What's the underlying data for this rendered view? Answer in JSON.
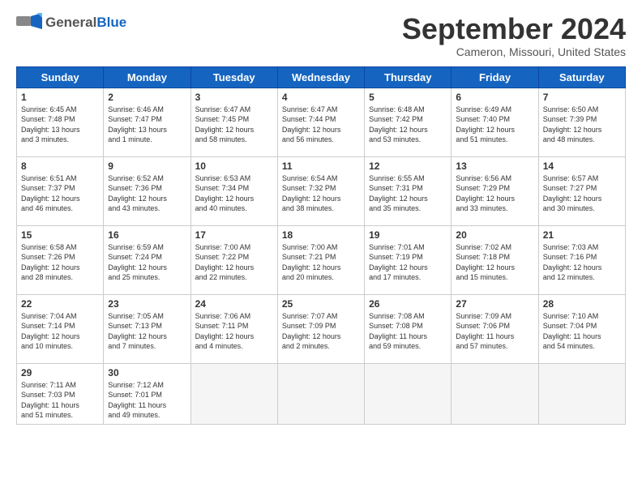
{
  "header": {
    "logo_general": "General",
    "logo_blue": "Blue",
    "title": "September 2024",
    "subtitle": "Cameron, Missouri, United States"
  },
  "days_of_week": [
    "Sunday",
    "Monday",
    "Tuesday",
    "Wednesday",
    "Thursday",
    "Friday",
    "Saturday"
  ],
  "weeks": [
    [
      {
        "day": "1",
        "info": "Sunrise: 6:45 AM\nSunset: 7:48 PM\nDaylight: 13 hours\nand 3 minutes."
      },
      {
        "day": "2",
        "info": "Sunrise: 6:46 AM\nSunset: 7:47 PM\nDaylight: 13 hours\nand 1 minute."
      },
      {
        "day": "3",
        "info": "Sunrise: 6:47 AM\nSunset: 7:45 PM\nDaylight: 12 hours\nand 58 minutes."
      },
      {
        "day": "4",
        "info": "Sunrise: 6:47 AM\nSunset: 7:44 PM\nDaylight: 12 hours\nand 56 minutes."
      },
      {
        "day": "5",
        "info": "Sunrise: 6:48 AM\nSunset: 7:42 PM\nDaylight: 12 hours\nand 53 minutes."
      },
      {
        "day": "6",
        "info": "Sunrise: 6:49 AM\nSunset: 7:40 PM\nDaylight: 12 hours\nand 51 minutes."
      },
      {
        "day": "7",
        "info": "Sunrise: 6:50 AM\nSunset: 7:39 PM\nDaylight: 12 hours\nand 48 minutes."
      }
    ],
    [
      {
        "day": "8",
        "info": "Sunrise: 6:51 AM\nSunset: 7:37 PM\nDaylight: 12 hours\nand 46 minutes."
      },
      {
        "day": "9",
        "info": "Sunrise: 6:52 AM\nSunset: 7:36 PM\nDaylight: 12 hours\nand 43 minutes."
      },
      {
        "day": "10",
        "info": "Sunrise: 6:53 AM\nSunset: 7:34 PM\nDaylight: 12 hours\nand 40 minutes."
      },
      {
        "day": "11",
        "info": "Sunrise: 6:54 AM\nSunset: 7:32 PM\nDaylight: 12 hours\nand 38 minutes."
      },
      {
        "day": "12",
        "info": "Sunrise: 6:55 AM\nSunset: 7:31 PM\nDaylight: 12 hours\nand 35 minutes."
      },
      {
        "day": "13",
        "info": "Sunrise: 6:56 AM\nSunset: 7:29 PM\nDaylight: 12 hours\nand 33 minutes."
      },
      {
        "day": "14",
        "info": "Sunrise: 6:57 AM\nSunset: 7:27 PM\nDaylight: 12 hours\nand 30 minutes."
      }
    ],
    [
      {
        "day": "15",
        "info": "Sunrise: 6:58 AM\nSunset: 7:26 PM\nDaylight: 12 hours\nand 28 minutes."
      },
      {
        "day": "16",
        "info": "Sunrise: 6:59 AM\nSunset: 7:24 PM\nDaylight: 12 hours\nand 25 minutes."
      },
      {
        "day": "17",
        "info": "Sunrise: 7:00 AM\nSunset: 7:22 PM\nDaylight: 12 hours\nand 22 minutes."
      },
      {
        "day": "18",
        "info": "Sunrise: 7:00 AM\nSunset: 7:21 PM\nDaylight: 12 hours\nand 20 minutes."
      },
      {
        "day": "19",
        "info": "Sunrise: 7:01 AM\nSunset: 7:19 PM\nDaylight: 12 hours\nand 17 minutes."
      },
      {
        "day": "20",
        "info": "Sunrise: 7:02 AM\nSunset: 7:18 PM\nDaylight: 12 hours\nand 15 minutes."
      },
      {
        "day": "21",
        "info": "Sunrise: 7:03 AM\nSunset: 7:16 PM\nDaylight: 12 hours\nand 12 minutes."
      }
    ],
    [
      {
        "day": "22",
        "info": "Sunrise: 7:04 AM\nSunset: 7:14 PM\nDaylight: 12 hours\nand 10 minutes."
      },
      {
        "day": "23",
        "info": "Sunrise: 7:05 AM\nSunset: 7:13 PM\nDaylight: 12 hours\nand 7 minutes."
      },
      {
        "day": "24",
        "info": "Sunrise: 7:06 AM\nSunset: 7:11 PM\nDaylight: 12 hours\nand 4 minutes."
      },
      {
        "day": "25",
        "info": "Sunrise: 7:07 AM\nSunset: 7:09 PM\nDaylight: 12 hours\nand 2 minutes."
      },
      {
        "day": "26",
        "info": "Sunrise: 7:08 AM\nSunset: 7:08 PM\nDaylight: 11 hours\nand 59 minutes."
      },
      {
        "day": "27",
        "info": "Sunrise: 7:09 AM\nSunset: 7:06 PM\nDaylight: 11 hours\nand 57 minutes."
      },
      {
        "day": "28",
        "info": "Sunrise: 7:10 AM\nSunset: 7:04 PM\nDaylight: 11 hours\nand 54 minutes."
      }
    ],
    [
      {
        "day": "29",
        "info": "Sunrise: 7:11 AM\nSunset: 7:03 PM\nDaylight: 11 hours\nand 51 minutes."
      },
      {
        "day": "30",
        "info": "Sunrise: 7:12 AM\nSunset: 7:01 PM\nDaylight: 11 hours\nand 49 minutes."
      },
      {
        "day": "",
        "info": ""
      },
      {
        "day": "",
        "info": ""
      },
      {
        "day": "",
        "info": ""
      },
      {
        "day": "",
        "info": ""
      },
      {
        "day": "",
        "info": ""
      }
    ]
  ]
}
